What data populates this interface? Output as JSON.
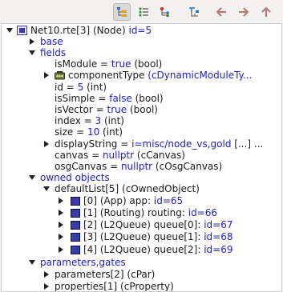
{
  "toolbar": {
    "buttons": [
      {
        "name": "group-by-category-button",
        "icon": "category-tree-icon",
        "active": true
      },
      {
        "name": "flat-view-button",
        "icon": "flat-list-icon",
        "active": false
      },
      {
        "name": "children-view-button",
        "icon": "children-tree-icon",
        "active": false
      },
      {
        "name": "inheritance-view-button",
        "icon": "inheritance-tree-icon",
        "active": false
      },
      {
        "name": "back-button",
        "icon": "arrow-left-icon",
        "active": false
      },
      {
        "name": "forward-button",
        "icon": "arrow-right-icon",
        "active": false
      },
      {
        "name": "up-button",
        "icon": "arrow-up-icon",
        "active": false
      }
    ]
  },
  "tree": {
    "root": {
      "prefix": "Net10.rte[3] (Node) ",
      "id": "id=5"
    },
    "base": "base",
    "fields": "fields",
    "f_isModule": {
      "label": "isModule = ",
      "value": "true",
      "type": " (bool)"
    },
    "f_componentType": {
      "label": "componentType ",
      "value": "(cDynamicModuleTy..."
    },
    "f_id": {
      "label": "id = ",
      "value": "5",
      "type": " (int)"
    },
    "f_isSimple": {
      "label": "isSimple = ",
      "value": "false",
      "type": " (bool)"
    },
    "f_isVector": {
      "label": "isVector = ",
      "value": "true",
      "type": " (bool)"
    },
    "f_index": {
      "label": "index = ",
      "value": "3",
      "type": " (int)"
    },
    "f_size": {
      "label": "size = ",
      "value": "10",
      "type": " (int)"
    },
    "f_displayString": {
      "label": "displayString = ",
      "value": "i=misc/node_vs,gold",
      "type": " [...] ..."
    },
    "f_canvas": {
      "label": "canvas = ",
      "value": "nullptr",
      "type": " (cCanvas)"
    },
    "f_osgCanvas": {
      "label": "osgCanvas = ",
      "value": "nullptr",
      "type": " (cOsgCanvas)"
    },
    "owned": "owned objects",
    "defaultList": "defaultList[5] (cOwnedObject)",
    "items": [
      {
        "text": "[0] (App) app: ",
        "id": "id=65"
      },
      {
        "text": "[1] (Routing) routing: ",
        "id": "id=66"
      },
      {
        "text": "[2] (L2Queue) queue[0]: ",
        "id": "id=67"
      },
      {
        "text": "[3] (L2Queue) queue[1]: ",
        "id": "id=68"
      },
      {
        "text": "[4] (L2Queue) queue[2]: ",
        "id": "id=69"
      }
    ],
    "paramsGates": "parameters,gates",
    "parameters": "parameters[2] (cPar)",
    "properties": "properties[1] (cProperty)"
  },
  "colors": {
    "blue": "#2020c8",
    "toolbar_bg": "#f2f1f0",
    "module_icon": "#3b3ba8"
  }
}
